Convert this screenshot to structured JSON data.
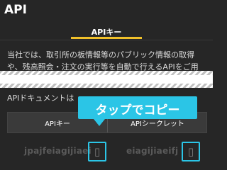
{
  "app": {
    "title": "API"
  },
  "tabs": [
    {
      "label": "APIキー",
      "active": true
    }
  ],
  "description": {
    "line1": "当社では、取引所の板情報等のパブリック情報の取得",
    "line2": "や、残高照会・注文の実行等を自動で行えるAPIをご用"
  },
  "docs": {
    "heading": "APIドキュメントは"
  },
  "api_keys": {
    "headers": {
      "key": "APIキー",
      "secret": "APIシークレット"
    },
    "key_value": "jpajfeiagijiaei",
    "secret_value": "eiagijiaeifj"
  },
  "callout": {
    "text": "タップでコピー"
  },
  "icons": {
    "copy_key": "copy-icon",
    "copy_secret": "copy-icon"
  },
  "colors": {
    "accent": "#2bc5e6",
    "tab_underline": "#f0c02a",
    "background": "#262626"
  }
}
